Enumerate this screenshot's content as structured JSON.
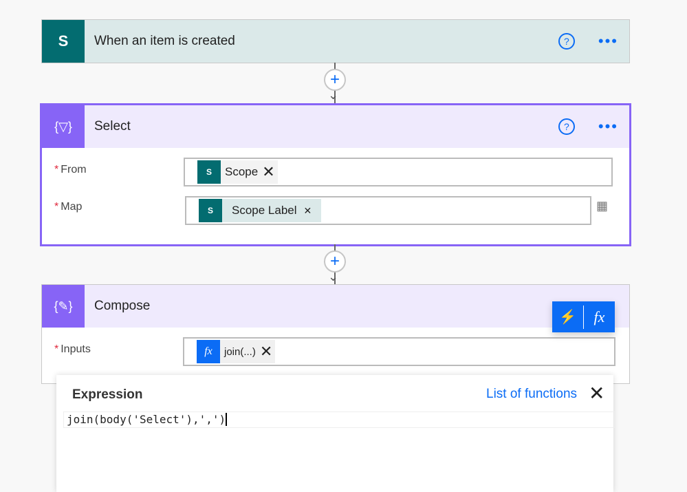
{
  "trigger": {
    "title": "When an item is created",
    "icon": "sharepoint-icon"
  },
  "select": {
    "title": "Select",
    "from_label": "From",
    "from_token": "Scope",
    "map_label": "Map",
    "map_token": "Scope Label",
    "required": "*"
  },
  "compose": {
    "title": "Compose",
    "inputs_label": "Inputs",
    "inputs_token": "join(...)"
  },
  "expression": {
    "title": "Expression",
    "list_link": "List of functions",
    "value": "join(body('Select'),',')"
  },
  "colors": {
    "sharepoint": "#036c70",
    "data_ops": "#8764f6",
    "accent": "#0b6cf5"
  }
}
